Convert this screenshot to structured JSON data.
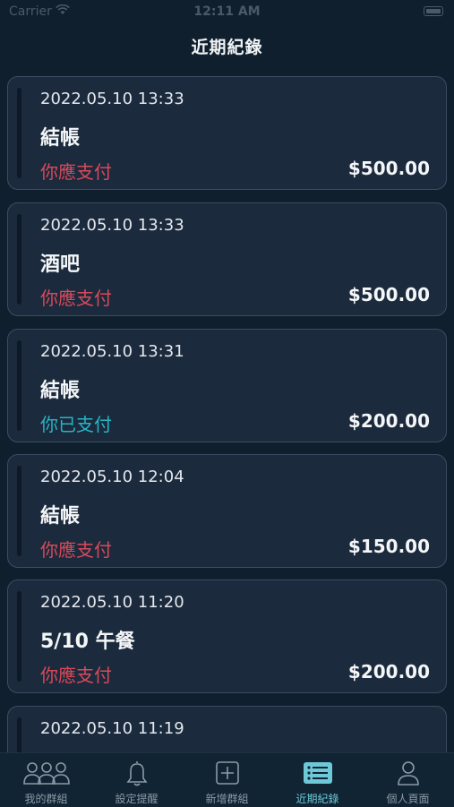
{
  "status_bar": {
    "carrier": "Carrier",
    "time": "12:11 AM"
  },
  "header": {
    "title": "近期紀錄"
  },
  "records": [
    {
      "date": "2022.05.10 13:33",
      "title": "結帳",
      "status": "你應支付",
      "status_type": "pay",
      "amount": "$500.00"
    },
    {
      "date": "2022.05.10 13:33",
      "title": "酒吧",
      "status": "你應支付",
      "status_type": "pay",
      "amount": "$500.00"
    },
    {
      "date": "2022.05.10 13:31",
      "title": "結帳",
      "status": "你已支付",
      "status_type": "paid",
      "amount": "$200.00"
    },
    {
      "date": "2022.05.10 12:04",
      "title": "結帳",
      "status": "你應支付",
      "status_type": "pay",
      "amount": "$150.00"
    },
    {
      "date": "2022.05.10 11:20",
      "title": "5/10 午餐",
      "status": "你應支付",
      "status_type": "pay",
      "amount": "$200.00"
    },
    {
      "date": "2022.05.10 11:19",
      "title": "",
      "status": "",
      "status_type": "pay",
      "amount": ""
    }
  ],
  "colors": {
    "pay": "#d84a5a",
    "paid": "#26b5c5",
    "active_tab": "#6ec8d8"
  },
  "tabbar": {
    "tabs": [
      {
        "label": "我的群組",
        "icon": "group-icon",
        "active": false
      },
      {
        "label": "設定提醒",
        "icon": "bell-icon",
        "active": false
      },
      {
        "label": "新增群組",
        "icon": "add-square-icon",
        "active": false
      },
      {
        "label": "近期紀錄",
        "icon": "list-icon",
        "active": true
      },
      {
        "label": "個人頁面",
        "icon": "person-icon",
        "active": false
      }
    ]
  }
}
